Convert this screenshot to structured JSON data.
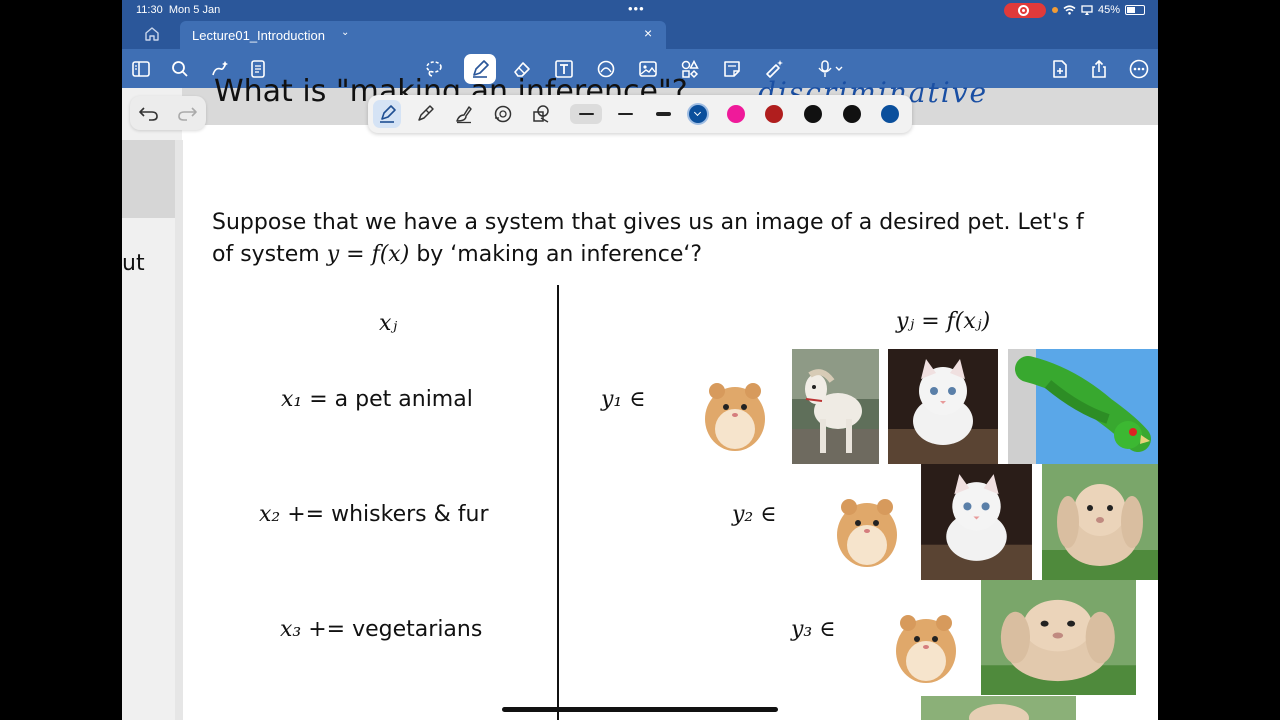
{
  "status_bar": {
    "time": "11:30",
    "date": "Mon 5 Jan",
    "battery": "45%"
  },
  "tab": {
    "title": "Lecture01_Introduction"
  },
  "toolbar": {
    "icons": [
      "sidebar-icon",
      "search-icon",
      "magic-icon",
      "notes-icon",
      "lasso-icon",
      "pen-icon",
      "eraser-icon",
      "text-box-icon",
      "shapes-icon",
      "image-icon",
      "elements-icon",
      "sticky-note-icon",
      "laser-pointer-icon",
      "microphone-icon",
      "add-page-icon",
      "share-icon",
      "more-icon"
    ]
  },
  "pen_toolbar": {
    "tools": [
      "fountain-pen",
      "ball-pen",
      "brush-pen",
      "highlighter",
      "shapes"
    ],
    "colors": [
      "#0b4f9c",
      "#ef1a9a",
      "#b01e1e",
      "#111111",
      "#111111",
      "#0b4f9c"
    ],
    "selected_color": "#0b4f9c"
  },
  "previous_slide": {
    "text_fragment": "ut"
  },
  "slide": {
    "heading_fragment": "What is \"making an inference\"?",
    "annotation": "discriminative",
    "intro_line1": "Suppose that we have a system that gives us an image of a desired pet.  Let's f",
    "intro_line2_prefix": "of system",
    "intro_line2_math": "y = f(x)",
    "intro_line2_suffix": "by ‘making an inference‘?",
    "left_header": "xⱼ",
    "right_header": "yⱼ = f(xⱼ)",
    "rows": [
      {
        "x": "x₁",
        "op": "=",
        "text": "a pet animal",
        "y": "y₁ ∈"
      },
      {
        "x": "x₂",
        "op": "+=",
        "text": "whiskers & fur",
        "y": "y₂ ∈"
      },
      {
        "x": "x₃",
        "op": "+=",
        "text": "vegetarians",
        "y": "y₃ ∈"
      }
    ]
  }
}
